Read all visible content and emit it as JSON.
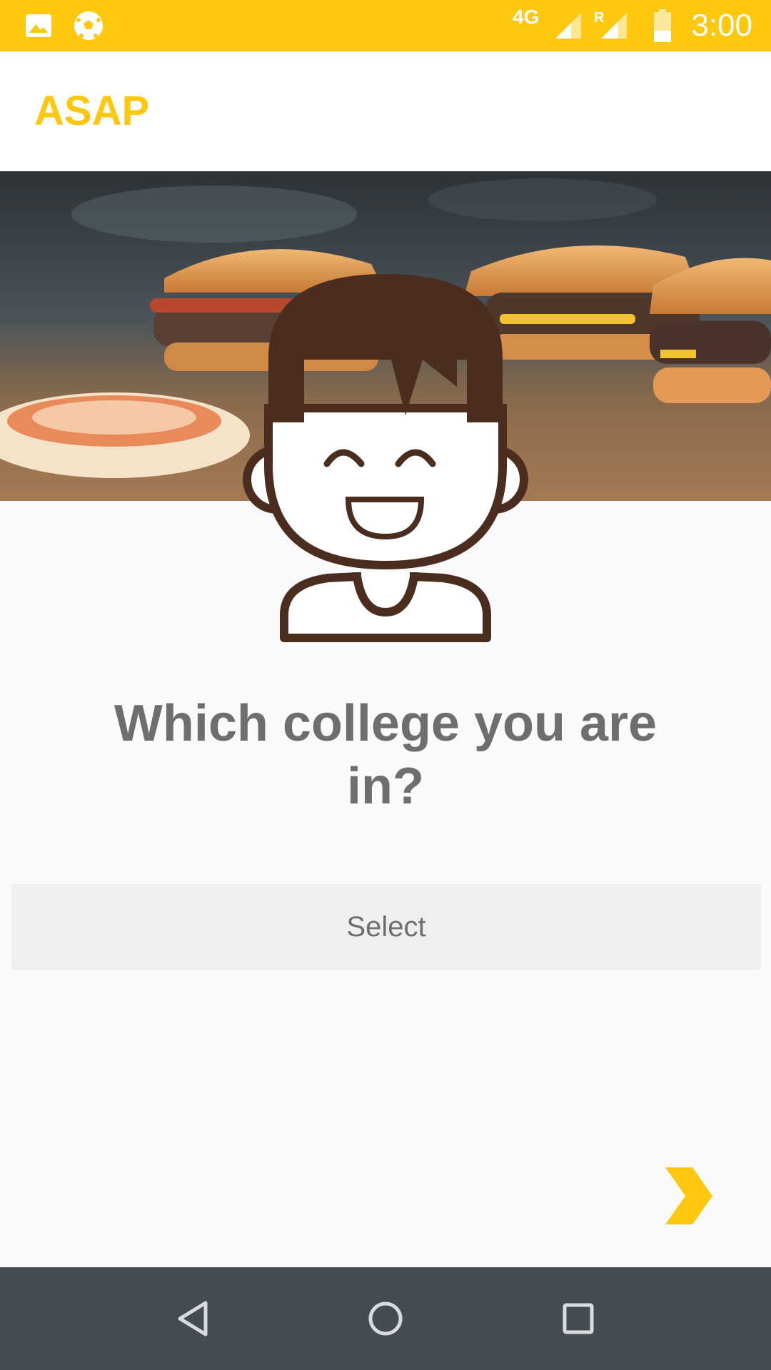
{
  "status_bar": {
    "time": "3:00",
    "network": "4G",
    "roaming": "R",
    "icons": [
      "image-notification-icon",
      "soccer-ball-icon",
      "signal-icon",
      "signal-roaming-icon",
      "battery-icon"
    ]
  },
  "app_bar": {
    "title": "ASAP"
  },
  "hero": {
    "description_icon": "burger-photo"
  },
  "main": {
    "question": "Which college you are in?",
    "select_label": "Select",
    "next_icon": "chevron-right-icon"
  },
  "nav_bar": {
    "icons": [
      "back-icon",
      "home-icon",
      "recents-icon"
    ]
  },
  "colors": {
    "accent": "#fdc80f",
    "nav_bg": "#444b52",
    "text_gray": "#6e6e6e",
    "avatar_brown": "#4a2d1f"
  }
}
